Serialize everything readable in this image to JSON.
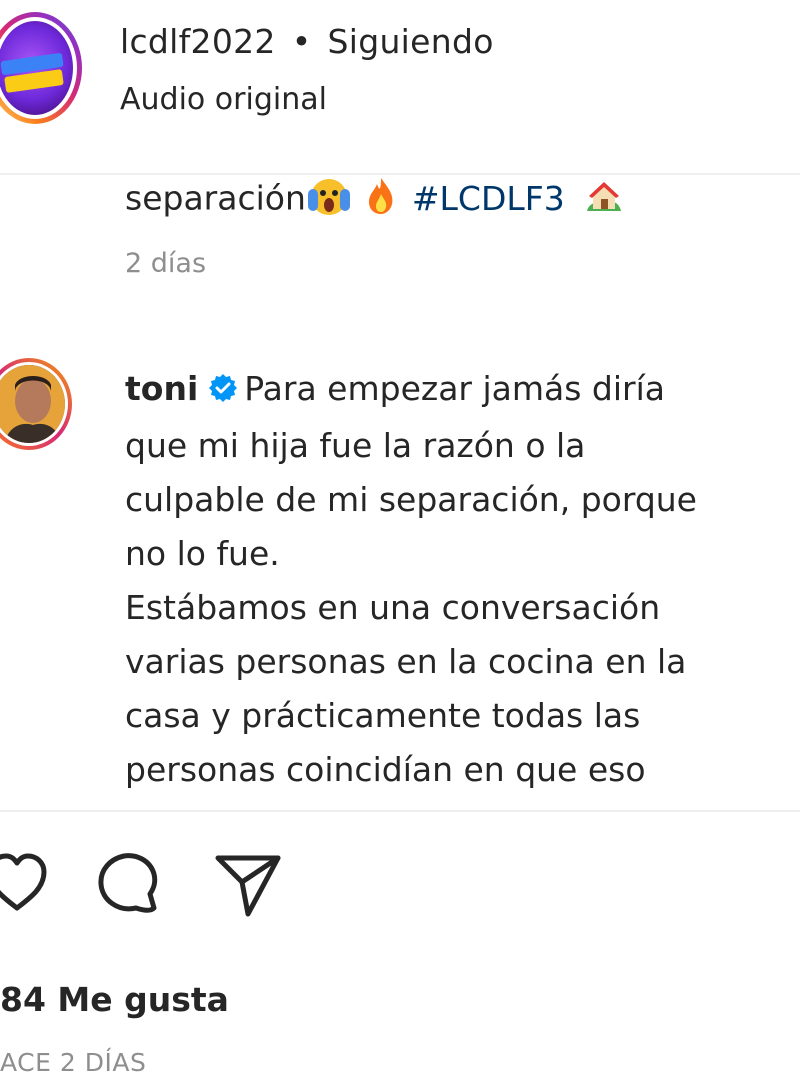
{
  "header": {
    "username": "lcdlf2022",
    "separator": "•",
    "follow_state": "Siguiendo",
    "audio_label": "Audio original"
  },
  "caption": {
    "text_tail": "separación",
    "hashtag": "#LCDLF3",
    "emojis": [
      "screaming-face-emoji",
      "fire-emoji",
      "house-emoji"
    ],
    "time": "2 días"
  },
  "comment": {
    "author": "toni",
    "verified": true,
    "text_lines": [
      "Para empezar jamás diría",
      "que mi hija fue la razón o la",
      "culpable de mi separación, porque",
      "no lo fue.",
      "Estábamos en una conversación",
      "varias personas en la cocina en la",
      "casa y prácticamente todas las",
      "personas coincidían en que eso"
    ]
  },
  "actions": {
    "icons": [
      "heart-icon",
      "comment-icon",
      "share-icon"
    ]
  },
  "likes_label": "84 Me gusta",
  "post_time": "ACE 2 DÍAS",
  "colors": {
    "text": "#262626",
    "muted": "#8e8e8e",
    "hashtag": "#00376b",
    "verified": "#0095f6"
  }
}
